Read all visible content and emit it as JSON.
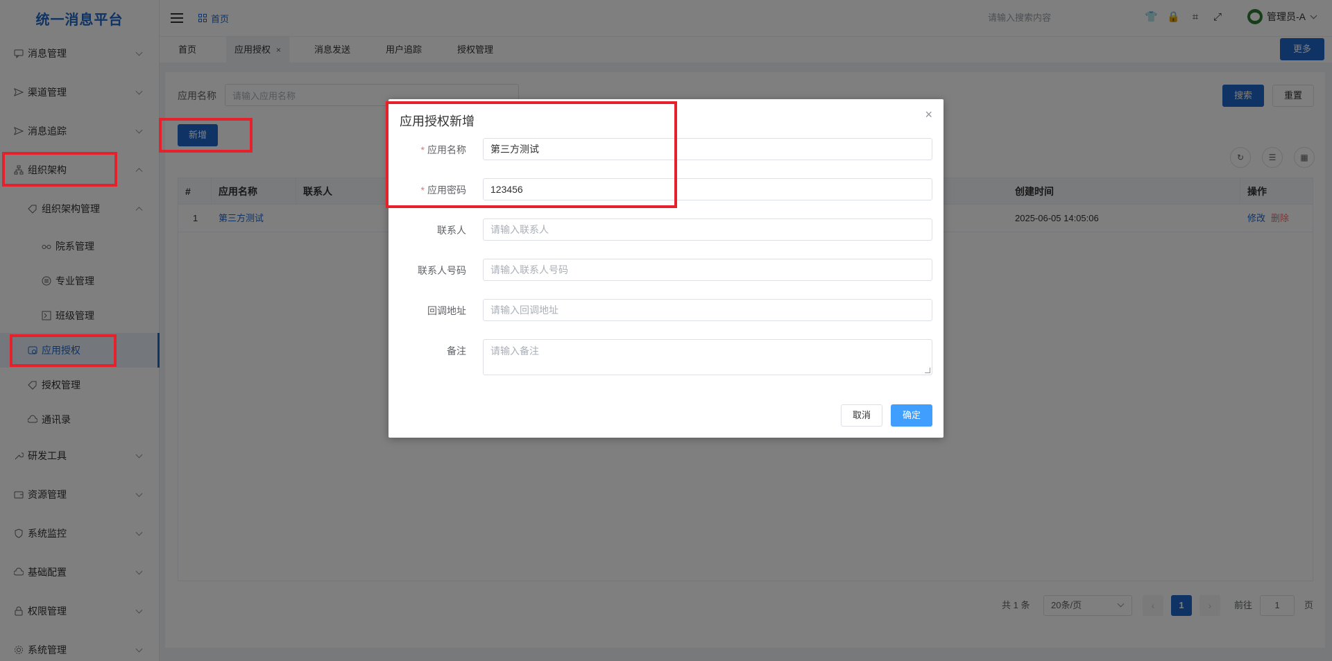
{
  "app": {
    "title": "统一消息平台"
  },
  "sidebar": {
    "items": [
      {
        "label": "消息管理",
        "icon": "message-icon"
      },
      {
        "label": "渠道管理",
        "icon": "send-icon"
      },
      {
        "label": "消息追踪",
        "icon": "send-icon"
      },
      {
        "label": "组织架构",
        "icon": "org-icon"
      },
      {
        "label": "组织架构管理",
        "icon": "tag-icon"
      },
      {
        "label": "院系管理",
        "icon": "glasses-icon"
      },
      {
        "label": "专业管理",
        "icon": "circle-list-icon"
      },
      {
        "label": "班级管理",
        "icon": "box-icon"
      },
      {
        "label": "应用授权",
        "icon": "app-auth-icon"
      },
      {
        "label": "授权管理",
        "icon": "tag-icon"
      },
      {
        "label": "通讯录",
        "icon": "cloud-icon"
      },
      {
        "label": "研发工具",
        "icon": "tool-icon"
      },
      {
        "label": "资源管理",
        "icon": "wallet-icon"
      },
      {
        "label": "系统监控",
        "icon": "shield-icon"
      },
      {
        "label": "基础配置",
        "icon": "cloud-icon"
      },
      {
        "label": "权限管理",
        "icon": "lock-icon"
      },
      {
        "label": "系统管理",
        "icon": "gear-icon"
      }
    ]
  },
  "header": {
    "breadcrumb": "首页",
    "search_placeholder": "请输入搜索内容",
    "user": "管理员-A"
  },
  "tabs": {
    "items": [
      "首页",
      "应用授权",
      "消息发送",
      "用户追踪",
      "授权管理"
    ],
    "close": "×",
    "more": "更多"
  },
  "search": {
    "label": "应用名称",
    "placeholder": "请输入应用名称",
    "search_btn": "搜索",
    "reset_btn": "重置",
    "add_btn": "新增"
  },
  "table": {
    "headers": [
      "#",
      "应用名称",
      "联系人",
      "创建时间",
      "操作"
    ],
    "rows": [
      {
        "index": "1",
        "name": "第三方测试",
        "contact": "",
        "created": "2025-06-05 14:05:06",
        "edit": "修改",
        "delete": "删除"
      }
    ]
  },
  "pager": {
    "total": "共 1 条",
    "page_size": "20条/页",
    "current": "1",
    "goto_label": "前往",
    "goto_value": "1",
    "page_unit": "页"
  },
  "dialog": {
    "title": "应用授权新增",
    "close": "×",
    "required_mark": "*",
    "fields": {
      "app_name": {
        "label": "应用名称",
        "value": "第三方测试"
      },
      "app_secret": {
        "label": "应用密码",
        "value": "123456"
      },
      "contact": {
        "label": "联系人",
        "placeholder": "请输入联系人"
      },
      "contact_phone": {
        "label": "联系人号码",
        "placeholder": "请输入联系人号码"
      },
      "callback": {
        "label": "回调地址",
        "placeholder": "请输入回调地址"
      },
      "remark": {
        "label": "备注",
        "placeholder": "请输入备注"
      }
    },
    "cancel": "取消",
    "confirm": "确定"
  },
  "colors": {
    "primary": "#1e66c8",
    "confirm": "#409eff",
    "danger": "#f56c6c",
    "annotation": "#e5222b"
  }
}
